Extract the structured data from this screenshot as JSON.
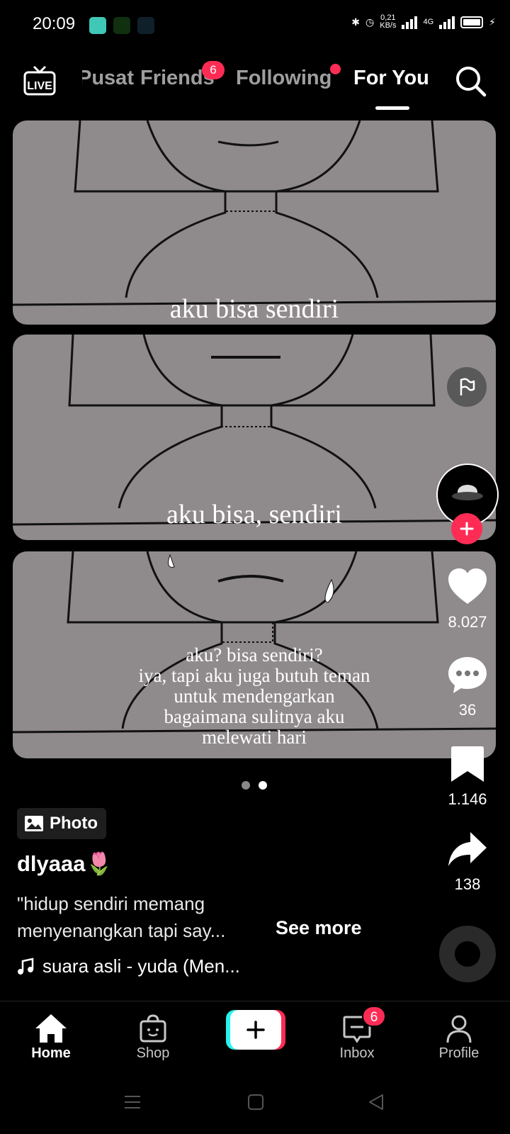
{
  "status_bar": {
    "time": "20:09",
    "net_speed": "0,21",
    "net_unit": "KB/s",
    "network_type": "4G"
  },
  "top_nav": {
    "live_label": "LIVE",
    "tabs": [
      {
        "label": "Pusat",
        "active": false
      },
      {
        "label": "Friends",
        "active": false,
        "badge": "6"
      },
      {
        "label": "Following",
        "active": false,
        "dot": true
      },
      {
        "label": "For You",
        "active": true
      }
    ]
  },
  "post": {
    "panels": [
      {
        "caption": "aku bisa sendiri"
      },
      {
        "caption": "aku bisa, sendiri"
      },
      {
        "caption_lines": [
          "aku? bisa sendiri?",
          "iya, tapi aku juga butuh teman",
          "untuk mendengarkan",
          "bagaimana sulitnya aku",
          "melewati hari"
        ]
      }
    ],
    "page_indicator": {
      "total": 2,
      "current": 2
    },
    "type_chip": "Photo",
    "username": "dlyaaa🌷",
    "caption_line1": "\"hidup sendiri memang",
    "caption_line2": "menyenangkan tapi say...",
    "see_more": "See more",
    "sound": "suara asli - yuda (Men..."
  },
  "actions": {
    "likes": "8.027",
    "comments": "36",
    "saves": "1.146",
    "shares": "138"
  },
  "bottom_nav": {
    "home": "Home",
    "shop": "Shop",
    "inbox": "Inbox",
    "inbox_badge": "6",
    "profile": "Profile"
  },
  "colors": {
    "accent": "#fe2c55",
    "cyan": "#25f4ee",
    "panel_gray": "#8f8a8b",
    "background": "#000000"
  },
  "icons": [
    "live-icon",
    "search-icon",
    "flag-icon",
    "heart-icon",
    "comment-icon",
    "bookmark-icon",
    "share-icon",
    "music-note-icon",
    "image-icon",
    "home-icon",
    "shop-icon",
    "plus-icon",
    "inbox-icon",
    "profile-icon"
  ]
}
